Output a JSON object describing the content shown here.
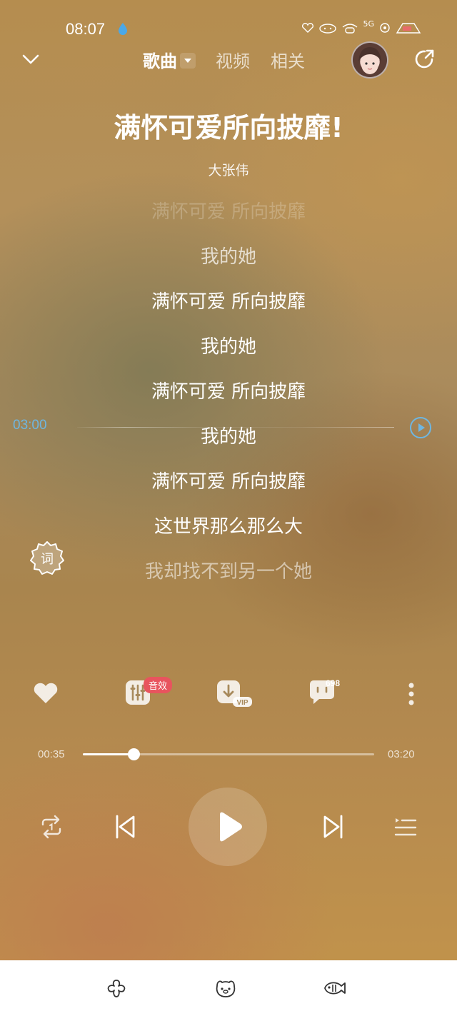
{
  "status_bar": {
    "time": "08:07",
    "network_label": "5G"
  },
  "nav": {
    "tabs": [
      {
        "label": "歌曲",
        "active": true
      },
      {
        "label": "视频",
        "active": false
      },
      {
        "label": "相关",
        "active": false
      }
    ]
  },
  "song": {
    "title": "满怀可爱所向披靡!",
    "artist": "大张伟"
  },
  "lyrics": [
    "满怀可爱 所向披靡",
    "我的她",
    "满怀可爱 所向披靡",
    "我的她",
    "满怀可爱 所向披靡",
    "我的她",
    "满怀可爱 所向披靡",
    "这世界那么那么大",
    "我却找不到另一个她"
  ],
  "lyric_seek": {
    "time": "03:00"
  },
  "lyric_toggle_label": "词",
  "actions": {
    "sound_effect_badge": "音效",
    "download_badge": "VIP",
    "comment_count": "698"
  },
  "playback": {
    "elapsed": "00:35",
    "total": "03:20",
    "progress_fraction": 0.175
  },
  "colors": {
    "accent_blue": "#6fb6e0",
    "badge_red": "#e8545e"
  },
  "icons": {
    "collapse": "chevron-down-icon",
    "share": "share-icon",
    "like": "heart-icon",
    "sound_effect": "equalizer-icon",
    "download": "download-icon",
    "comment": "comment-icon",
    "more": "more-dots-icon",
    "repeat": "repeat-icon",
    "previous": "previous-icon",
    "play": "play-icon",
    "next": "next-icon",
    "playlist": "playlist-icon"
  }
}
